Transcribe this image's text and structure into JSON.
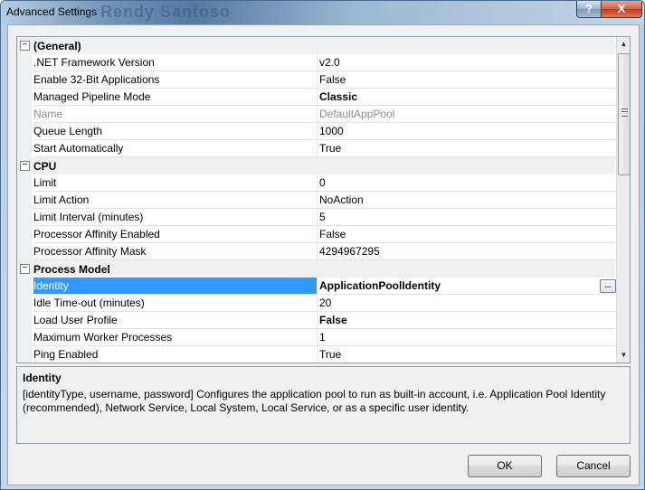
{
  "window": {
    "title": "Advanced Settings",
    "ghost_text": "Rendy Santoso",
    "help_label": "?",
    "close_label": "X"
  },
  "grid": {
    "rows": [
      {
        "kind": "category",
        "label": "(General)",
        "toggle": "⊟"
      },
      {
        "kind": "prop",
        "name": ".NET Framework Version",
        "value": "v2.0"
      },
      {
        "kind": "prop",
        "name": "Enable 32-Bit Applications",
        "value": "False"
      },
      {
        "kind": "prop",
        "name": "Managed Pipeline Mode",
        "value": "Classic",
        "bold": true
      },
      {
        "kind": "prop",
        "name": "Name",
        "value": "DefaultAppPool",
        "disabled": true
      },
      {
        "kind": "prop",
        "name": "Queue Length",
        "value": "1000"
      },
      {
        "kind": "prop",
        "name": "Start Automatically",
        "value": "True"
      },
      {
        "kind": "category",
        "label": "CPU",
        "toggle": "⊟"
      },
      {
        "kind": "prop",
        "name": "Limit",
        "value": "0"
      },
      {
        "kind": "prop",
        "name": "Limit Action",
        "value": "NoAction"
      },
      {
        "kind": "prop",
        "name": "Limit Interval (minutes)",
        "value": "5"
      },
      {
        "kind": "prop",
        "name": "Processor Affinity Enabled",
        "value": "False"
      },
      {
        "kind": "prop",
        "name": "Processor Affinity Mask",
        "value": "4294967295"
      },
      {
        "kind": "category",
        "label": "Process Model",
        "toggle": "⊟"
      },
      {
        "kind": "prop",
        "name": "Identity",
        "value": "ApplicationPoolIdentity",
        "bold": true,
        "selected": true,
        "ellipsis": "..."
      },
      {
        "kind": "prop",
        "name": "Idle Time-out (minutes)",
        "value": "20"
      },
      {
        "kind": "prop",
        "name": "Load User Profile",
        "value": "False",
        "bold": true
      },
      {
        "kind": "prop",
        "name": "Maximum Worker Processes",
        "value": "1"
      },
      {
        "kind": "prop",
        "name": "Ping Enabled",
        "value": "True"
      }
    ],
    "scroll_up_glyph": "▲",
    "scroll_down_glyph": "▼"
  },
  "description": {
    "title": "Identity",
    "text": "[identityType, username, password] Configures the application pool to run as built-in account, i.e. Application Pool Identity (recommended), Network Service, Local System, Local Service, or as a specific user identity."
  },
  "buttons": {
    "ok": "OK",
    "cancel": "Cancel"
  }
}
